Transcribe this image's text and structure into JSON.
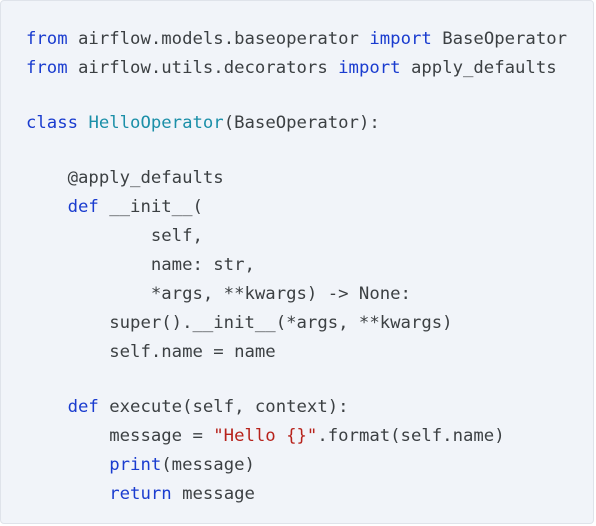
{
  "code": {
    "language": "python",
    "colors": {
      "background": "#f1f4f9",
      "text": "#3c4043",
      "keyword": "#1a3ccf",
      "class_name": "#1b8fa8",
      "string": "#b7221b"
    },
    "lines": [
      {
        "tokens": [
          {
            "t": "from",
            "c": "kw"
          },
          {
            "t": " airflow.models.baseoperator ",
            "c": "tx"
          },
          {
            "t": "import",
            "c": "kw"
          },
          {
            "t": " BaseOperator",
            "c": "tx"
          }
        ]
      },
      {
        "tokens": [
          {
            "t": "from",
            "c": "kw"
          },
          {
            "t": " airflow.utils.decorators ",
            "c": "tx"
          },
          {
            "t": "import",
            "c": "kw"
          },
          {
            "t": " apply_defaults",
            "c": "tx"
          }
        ]
      },
      {
        "blank": true
      },
      {
        "tokens": [
          {
            "t": "class",
            "c": "kw"
          },
          {
            "t": " ",
            "c": "tx"
          },
          {
            "t": "HelloOperator",
            "c": "cls"
          },
          {
            "t": "(BaseOperator):",
            "c": "tx"
          }
        ]
      },
      {
        "blank": true
      },
      {
        "tokens": [
          {
            "t": "    @apply_defaults",
            "c": "tx"
          }
        ]
      },
      {
        "tokens": [
          {
            "t": "    ",
            "c": "tx"
          },
          {
            "t": "def",
            "c": "kw"
          },
          {
            "t": " __init__(",
            "c": "tx"
          }
        ]
      },
      {
        "tokens": [
          {
            "t": "            self,",
            "c": "tx"
          }
        ]
      },
      {
        "tokens": [
          {
            "t": "            name: str,",
            "c": "tx"
          }
        ]
      },
      {
        "tokens": [
          {
            "t": "            *args, **kwargs) -> None:",
            "c": "tx"
          }
        ]
      },
      {
        "tokens": [
          {
            "t": "        super().__init__(*args, **kwargs)",
            "c": "tx"
          }
        ]
      },
      {
        "tokens": [
          {
            "t": "        self.name = name",
            "c": "tx"
          }
        ]
      },
      {
        "blank": true
      },
      {
        "tokens": [
          {
            "t": "    ",
            "c": "tx"
          },
          {
            "t": "def",
            "c": "kw"
          },
          {
            "t": " execute(self, context):",
            "c": "tx"
          }
        ]
      },
      {
        "tokens": [
          {
            "t": "        message = ",
            "c": "tx"
          },
          {
            "t": "\"Hello {}\"",
            "c": "str"
          },
          {
            "t": ".format(self.name)",
            "c": "tx"
          }
        ]
      },
      {
        "tokens": [
          {
            "t": "        ",
            "c": "tx"
          },
          {
            "t": "print",
            "c": "bi"
          },
          {
            "t": "(message)",
            "c": "tx"
          }
        ]
      },
      {
        "tokens": [
          {
            "t": "        ",
            "c": "tx"
          },
          {
            "t": "return",
            "c": "kw"
          },
          {
            "t": " message",
            "c": "tx"
          }
        ]
      }
    ]
  }
}
